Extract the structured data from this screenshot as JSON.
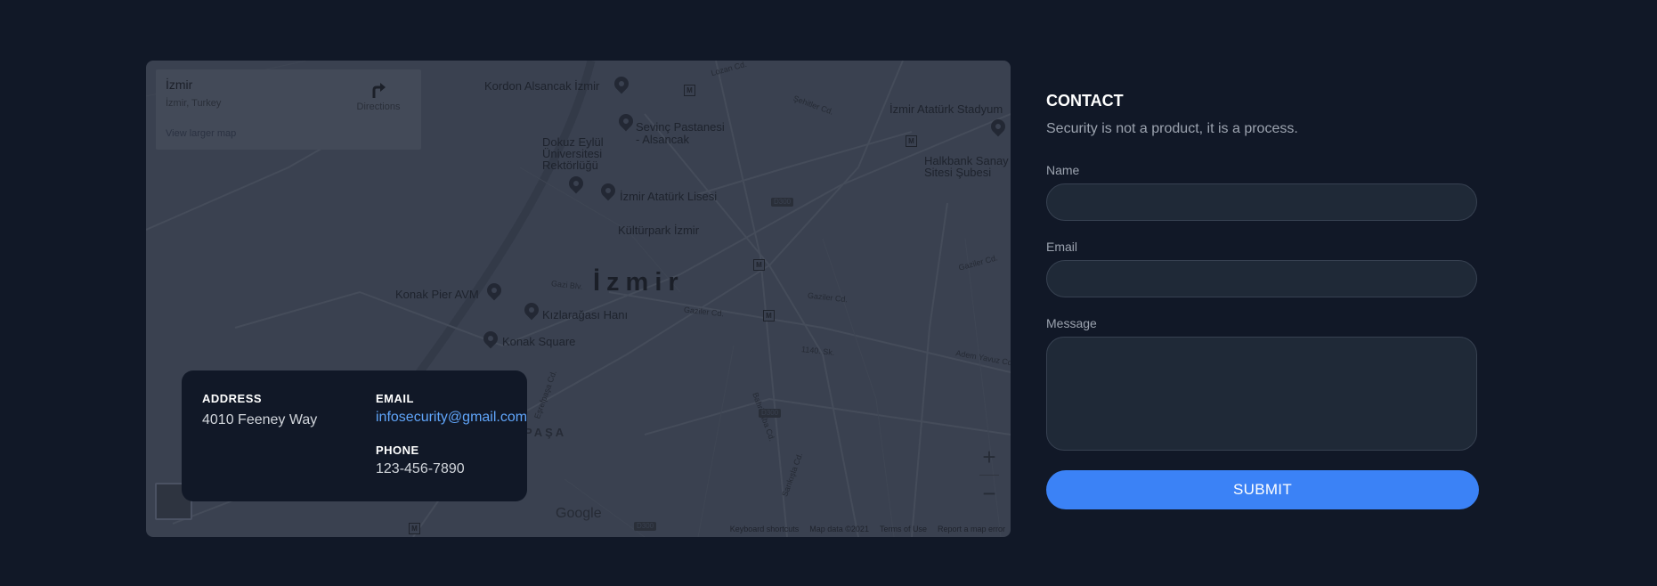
{
  "map": {
    "info_title": "İzmir",
    "info_subtitle": "İzmir, Turkey",
    "directions_label": "Directions",
    "view_larger": "View larger map",
    "city_label": "İzmir",
    "places": {
      "kordon": "Kordon Alsancak İzmir",
      "sevinc_1": "Sevinç Pastanesi",
      "sevinc_2": "- Alsancak",
      "dokuz_1": "Dokuz Eylül",
      "dokuz_2": "Üniversitesi",
      "dokuz_3": "Rektörlüğü",
      "ataturk_lisesi": "İzmir Atatürk Lisesi",
      "kulturpark": "Kültürpark İzmir",
      "konak_pier": "Konak Pier AVM",
      "kizlaragasi": "Kızlarağası Hanı",
      "konak_square": "Konak Square",
      "stadium": "İzmir Atatürk Stadyum",
      "halkbank_1": "Halkbank Sanay",
      "halkbank_2": "Sitesi Şubesi",
      "pasa": "PAŞA"
    },
    "streets": {
      "s1": "Lozan Cd.",
      "s2": "Şehitler Cd.",
      "s3": "Gazi Blv.",
      "s4": "Gaziler Cd.",
      "s5": "Gaziler Cd.",
      "s6": "1140. Sk.",
      "s7": "Gaziler Cd.",
      "s8": "Adem Yavuz Cd.",
      "s9": "Eşrefpaşa Cd.",
      "s10": "Bahribaba Cd.",
      "s11": "Sarıkışla Cd."
    },
    "roads": {
      "r1": "D300",
      "r2": "D300",
      "r3": "D300"
    },
    "metro_letter": "M",
    "zoom_in": "+",
    "zoom_out": "−",
    "google": "Google",
    "attribution": {
      "keyboard": "Keyboard shortcuts",
      "mapdata": "Map data ©2021",
      "terms": "Terms of Use",
      "report": "Report a map error"
    }
  },
  "contact_card": {
    "address_label": "ADDRESS",
    "address_value": "4010 Feeney Way",
    "email_label": "EMAIL",
    "email_value": "infosecurity@gmail.com",
    "phone_label": "PHONE",
    "phone_value": "123-456-7890"
  },
  "form": {
    "title": "CONTACT",
    "description": "Security is not a product, it is a process.",
    "name_label": "Name",
    "email_label": "Email",
    "message_label": "Message",
    "name_value": "",
    "email_value": "",
    "message_value": "",
    "submit_label": "SUBMIT"
  },
  "colors": {
    "page_bg": "#111827",
    "accent": "#3b82f6",
    "link": "#60a5fa",
    "field_bg": "#1f2937"
  }
}
